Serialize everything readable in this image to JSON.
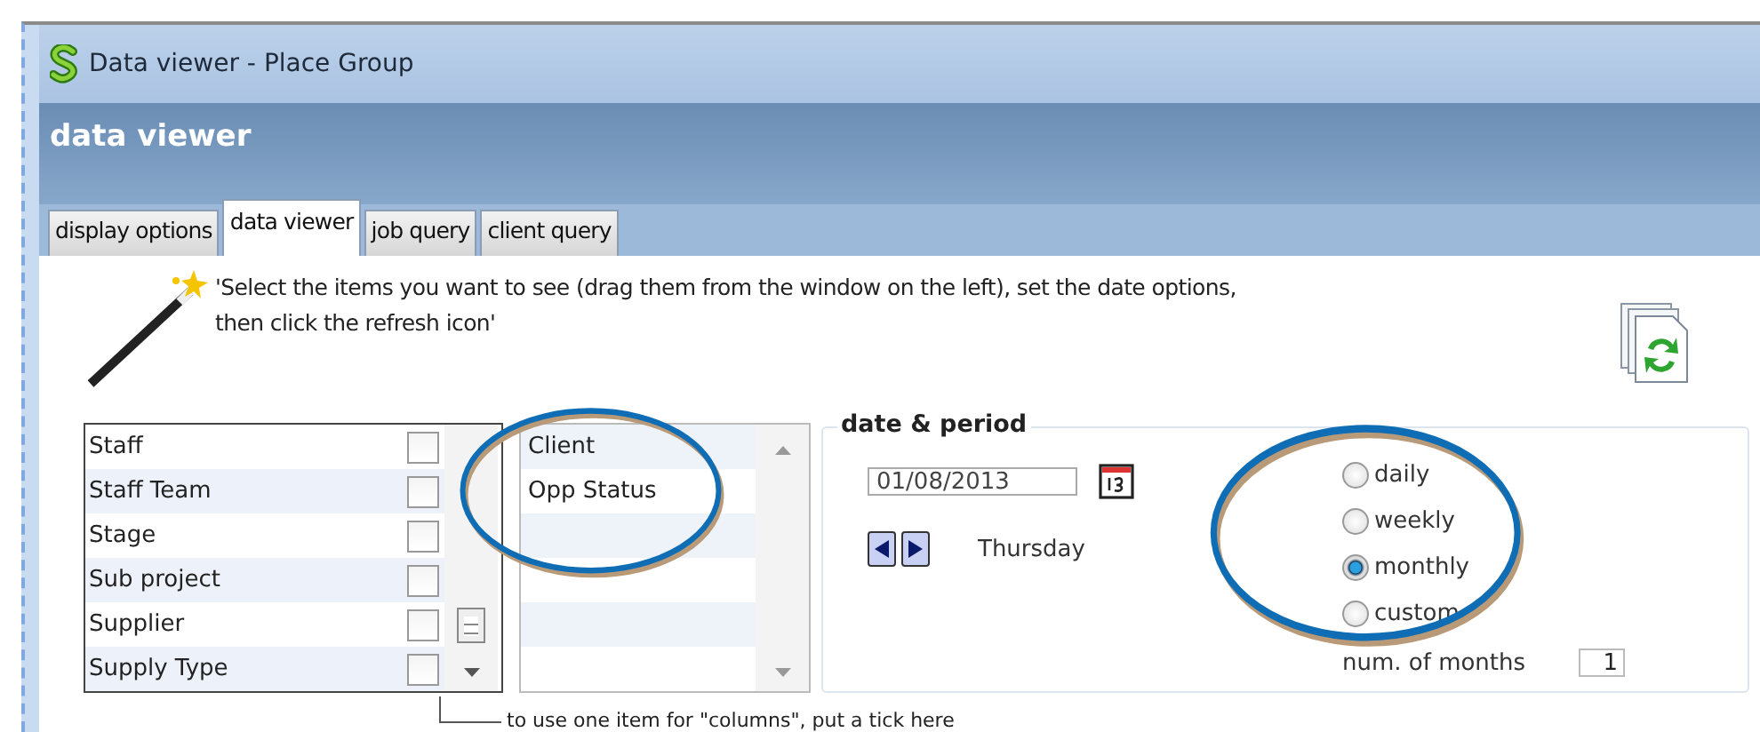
{
  "window": {
    "title": "Data viewer - Place Group"
  },
  "header": {
    "title": "data viewer"
  },
  "tabs": [
    {
      "label": "display options",
      "selected": false
    },
    {
      "label": "data viewer",
      "selected": true
    },
    {
      "label": "job query",
      "selected": false
    },
    {
      "label": "client query",
      "selected": false
    }
  ],
  "instruction": "'Select the items you want to see (drag them from the window on the left), set the date options,\nthen click the refresh icon'",
  "fields_list": {
    "items": [
      {
        "label": "Staff",
        "checked": false
      },
      {
        "label": "Staff Team",
        "checked": false
      },
      {
        "label": "Stage",
        "checked": false
      },
      {
        "label": "Sub project",
        "checked": false
      },
      {
        "label": "Supplier",
        "checked": false
      },
      {
        "label": "Supply Type",
        "checked": false
      }
    ]
  },
  "selected_list": {
    "items": [
      "Client",
      "Opp Status"
    ]
  },
  "date_period": {
    "title": "date & period",
    "date": "01/08/2013",
    "day": "Thursday",
    "periods": [
      {
        "label": "daily",
        "selected": false
      },
      {
        "label": "weekly",
        "selected": false
      },
      {
        "label": "monthly",
        "selected": true
      },
      {
        "label": "custom",
        "selected": false
      }
    ],
    "count_label": "num. of months",
    "count_value": "1"
  },
  "hint": "to use one item for \"columns\", put a tick here"
}
